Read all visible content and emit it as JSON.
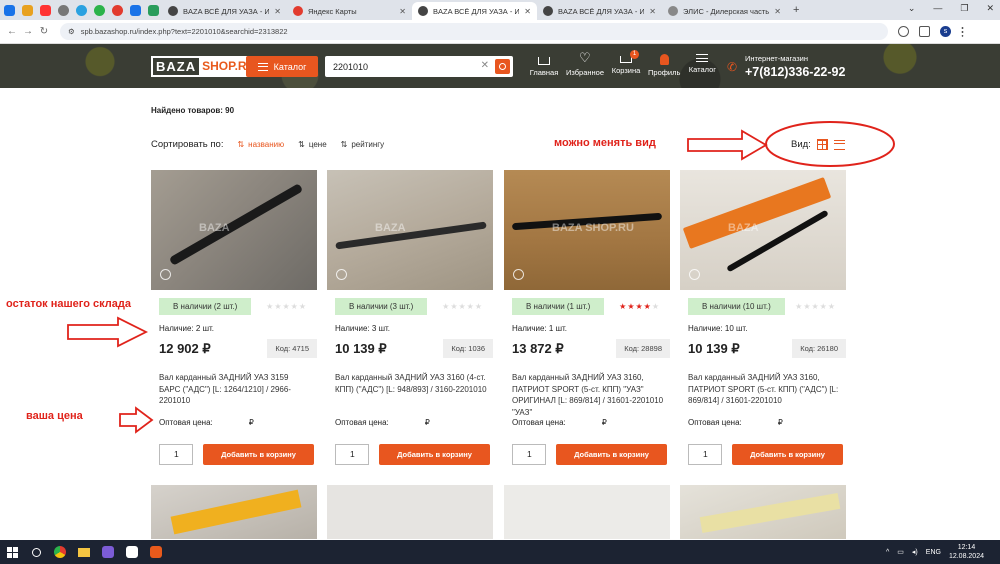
{
  "browser": {
    "tabs": [
      {
        "title": "BAZA ВСЁ ДЛЯ УАЗА - Интер",
        "active": false
      },
      {
        "title": "Яндекс Карты",
        "active": false
      },
      {
        "title": "BAZA ВСЁ ДЛЯ УАЗА - Интер",
        "active": true
      },
      {
        "title": "BAZA ВСЁ ДЛЯ УАЗА - Интер",
        "active": false
      },
      {
        "title": "ЭЛИС - Дилерская часть.",
        "active": false
      }
    ],
    "url": "spb.bazashop.ru/index.php?text=2201010&searchid=2313822",
    "profile_letter": "s"
  },
  "header": {
    "logo_left": "BAZA",
    "logo_right": "SHOP.RU",
    "catalog_label": "Каталог",
    "search_value": "2201010",
    "nav": [
      {
        "label": "Главная",
        "icon": "home-icon"
      },
      {
        "label": "Избранное",
        "icon": "heart-icon"
      },
      {
        "label": "Корзина",
        "icon": "cart-icon",
        "badge": "1"
      },
      {
        "label": "Профиль",
        "icon": "user-icon"
      },
      {
        "label": "Каталог",
        "icon": "menu-icon"
      }
    ],
    "phone_label": "Интернет-магазин",
    "phone": "+7(812)336-22-92"
  },
  "results": {
    "found": "Найдено товаров: 90",
    "sort_label": "Сортировать по:",
    "sort_options": [
      "названию",
      "цене",
      "рейтингу"
    ],
    "view_label": "Вид:"
  },
  "annotations": {
    "view_note": "можно менять вид",
    "stock_note": "остаток нашего склада",
    "price_note": "ваша цена"
  },
  "products": [
    {
      "stock_badge": "В наличии (2 шт.)",
      "rating": 0,
      "qty_text": "Наличие: 2 шт.",
      "price": "12 902 ₽",
      "code": "Код: 4715",
      "name": "Вал карданный ЗАДНИЙ УАЗ 3159 БАРС (\"АДС\") [L: 1264/1210] / 2966-2201010",
      "wholesale_label": "Оптовая цена:",
      "wholesale_currency": "₽",
      "qty_value": "1",
      "buy_label": "Добавить в корзину"
    },
    {
      "stock_badge": "В наличии (3 шт.)",
      "rating": 0,
      "qty_text": "Наличие: 3 шт.",
      "price": "10 139 ₽",
      "code": "Код: 1036",
      "name": "Вал карданный ЗАДНИЙ УАЗ 3160 (4-ст. КПП) (\"АДС\") [L: 948/893] / 3160-2201010",
      "wholesale_label": "Оптовая цена:",
      "wholesale_currency": "₽",
      "qty_value": "1",
      "buy_label": "Добавить в корзину"
    },
    {
      "stock_badge": "В наличии (1 шт.)",
      "rating": 4,
      "qty_text": "Наличие: 1 шт.",
      "price": "13 872 ₽",
      "code": "Код: 28898",
      "name": "Вал карданный ЗАДНИЙ УАЗ 3160, ПАТРИОТ SPORT (5-ст. КПП) \"УАЗ\" ОРИГИНАЛ [L: 869/814] / 31601-2201010 \"УАЗ\"",
      "wholesale_label": "Оптовая цена:",
      "wholesale_currency": "₽",
      "qty_value": "1",
      "buy_label": "Добавить в корзину"
    },
    {
      "stock_badge": "В наличии (10 шт.)",
      "rating": 0,
      "qty_text": "Наличие: 10 шт.",
      "price": "10 139 ₽",
      "code": "Код: 26180",
      "name": "Вал карданный ЗАДНИЙ УАЗ 3160, ПАТРИОТ SPORT (5-ст. КПП) (\"АДС\") [L: 869/814] / 31601-2201010",
      "wholesale_label": "Оптовая цена:",
      "wholesale_currency": "₽",
      "qty_value": "1",
      "buy_label": "Добавить в корзину"
    }
  ],
  "taskbar": {
    "lang": "ENG",
    "time": "12:14",
    "date": "12.08.2024"
  },
  "colors": {
    "accent": "#e8561f",
    "annotation": "#e0231b",
    "stock_bg": "#cfeecb"
  }
}
